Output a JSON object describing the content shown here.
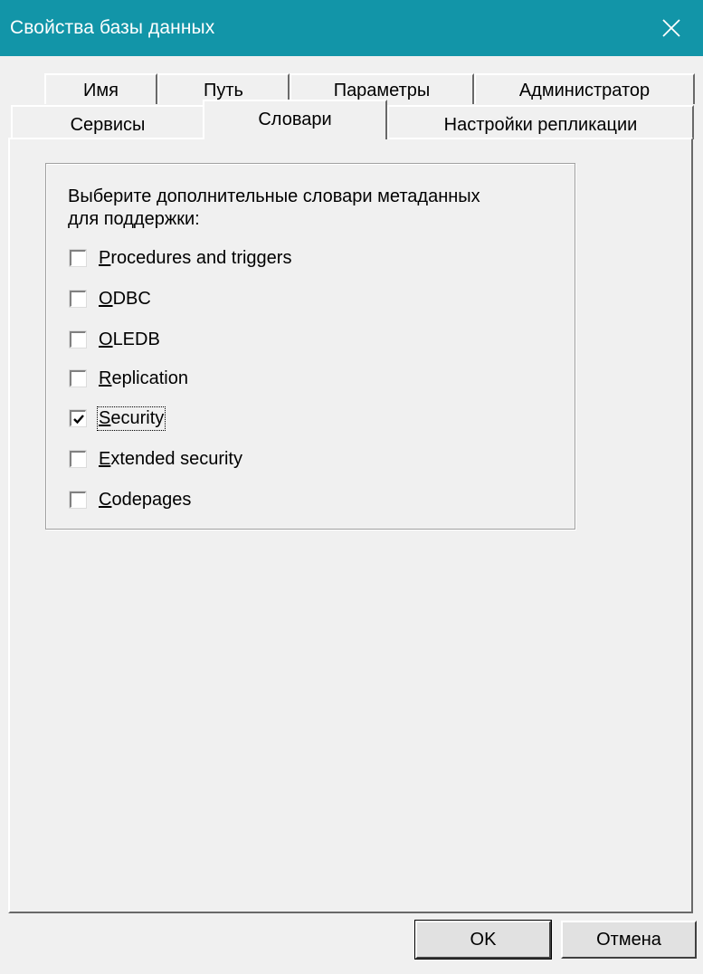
{
  "window": {
    "title": "Свойства базы данных",
    "accent": "#1295a8",
    "close_icon": "close-icon"
  },
  "tabs": {
    "row_back": [
      "Имя",
      "Путь",
      "Параметры",
      "Администратор"
    ],
    "row_front": [
      "Сервисы",
      "Словари",
      "Настройки репликации"
    ],
    "selected": "Словари"
  },
  "dictionaries": {
    "instruction_line1": "Выберите дополнительные словари метаданных",
    "instruction_line2": "для поддержки:",
    "items": [
      {
        "prefix": "",
        "mnemonic": "P",
        "rest": "rocedures and triggers",
        "checked": false
      },
      {
        "prefix": "",
        "mnemonic": "O",
        "rest": "DBC",
        "checked": false
      },
      {
        "prefix": "",
        "mnemonic": "O",
        "rest": "LEDB",
        "checked": false
      },
      {
        "prefix": "",
        "mnemonic": "R",
        "rest": "eplication",
        "checked": false
      },
      {
        "prefix": "",
        "mnemonic": "S",
        "rest": "ecurity",
        "checked": true
      },
      {
        "prefix": "",
        "mnemonic": "E",
        "rest": "xtended security",
        "checked": false
      },
      {
        "prefix": "",
        "mnemonic": "C",
        "rest": "odepages",
        "checked": false
      }
    ]
  },
  "buttons": {
    "ok": "OK",
    "cancel": "Отмена"
  }
}
